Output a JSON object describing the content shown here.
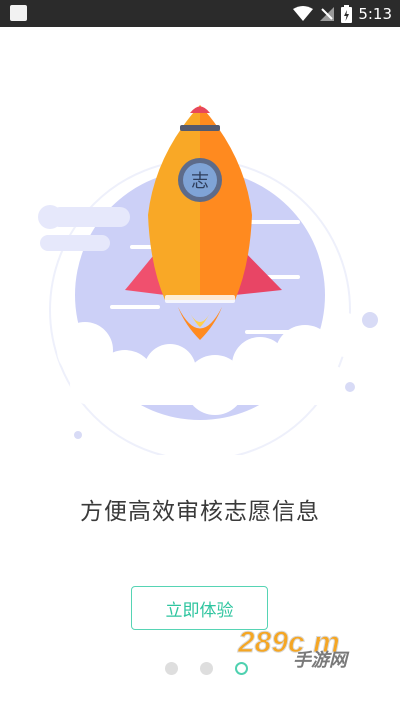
{
  "status_bar": {
    "time": "5:13",
    "icons": [
      "notification-square-icon",
      "wifi-icon",
      "no-signal-icon",
      "battery-charging-icon"
    ]
  },
  "hero": {
    "badge_text": "志",
    "colors": {
      "rocket_left": "#f9a826",
      "rocket_right": "#ff8a1f",
      "fins": "#f0506e",
      "circle": "#c9ccf7",
      "cloud": "#ffffff"
    }
  },
  "headline": "方便高效审核志愿信息",
  "cta": {
    "label": "立即体验",
    "color": "#2ec59f"
  },
  "pager": {
    "count": 3,
    "active_index": 2
  },
  "watermark": {
    "brand": "289c m",
    "sub": "手游网"
  }
}
